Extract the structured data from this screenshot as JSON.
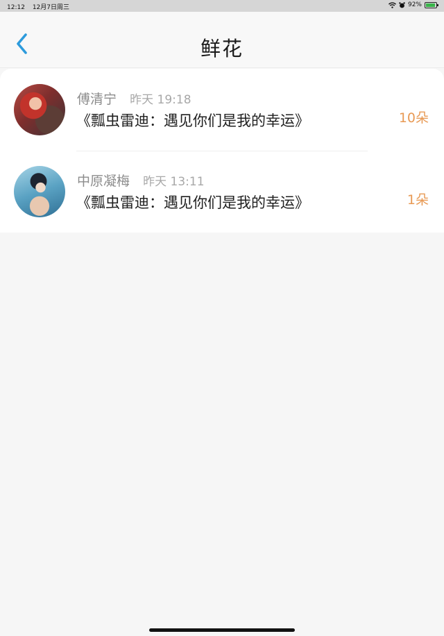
{
  "status_bar": {
    "time": "12:12",
    "date": "12月7日周三",
    "battery": "92%",
    "battery_level": 0.92,
    "icons": [
      "wifi-icon",
      "alarm-icon",
      "battery-charging-icon"
    ]
  },
  "nav": {
    "title": "鲜花",
    "back_icon": "chevron-left-icon"
  },
  "colors": {
    "accent": "#2d9bdc",
    "count": "#e89a55",
    "name": "#8c8c8c",
    "time": "#a8a8a8"
  },
  "gifts": [
    {
      "user": "傅清宁",
      "time": "昨天 19:18",
      "book": "《瓢虫雷迪：遇见你们是我的幸运》",
      "count": "10朵"
    },
    {
      "user": "中原凝梅",
      "time": "昨天 13:11",
      "book": "《瓢虫雷迪：遇见你们是我的幸运》",
      "count": "1朵"
    }
  ]
}
